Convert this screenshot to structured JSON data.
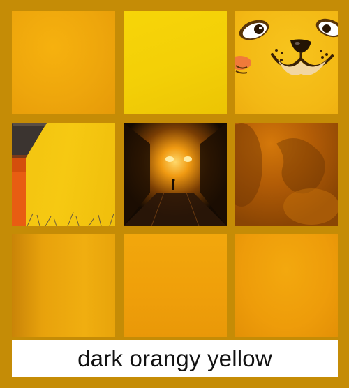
{
  "caption": "dark orangy yellow",
  "colors": {
    "background": "#c58c06",
    "caption_background": "#ffffff",
    "caption_text": "#111111"
  },
  "swatches": [
    {
      "position": "top-left",
      "color": "#eea60c"
    },
    {
      "position": "top-middle",
      "color": "#f3cf07"
    },
    {
      "position": "top-right",
      "color": "#f3b814",
      "depicts": "cartoon cat face"
    },
    {
      "position": "middle-left",
      "color": "#f6c912",
      "depicts": "yellow house wall with red trim"
    },
    {
      "position": "middle-center",
      "color": "#1a0d02",
      "depicts": "figure in glowing orange tunnel"
    },
    {
      "position": "middle-right",
      "color": "#b55e06",
      "depicts": "rusty orange texture"
    },
    {
      "position": "bottom-left",
      "color": "#e8a20c"
    },
    {
      "position": "bottom-middle",
      "color": "#ef9f0a"
    },
    {
      "position": "bottom-right",
      "color": "#ee9c0a"
    }
  ]
}
